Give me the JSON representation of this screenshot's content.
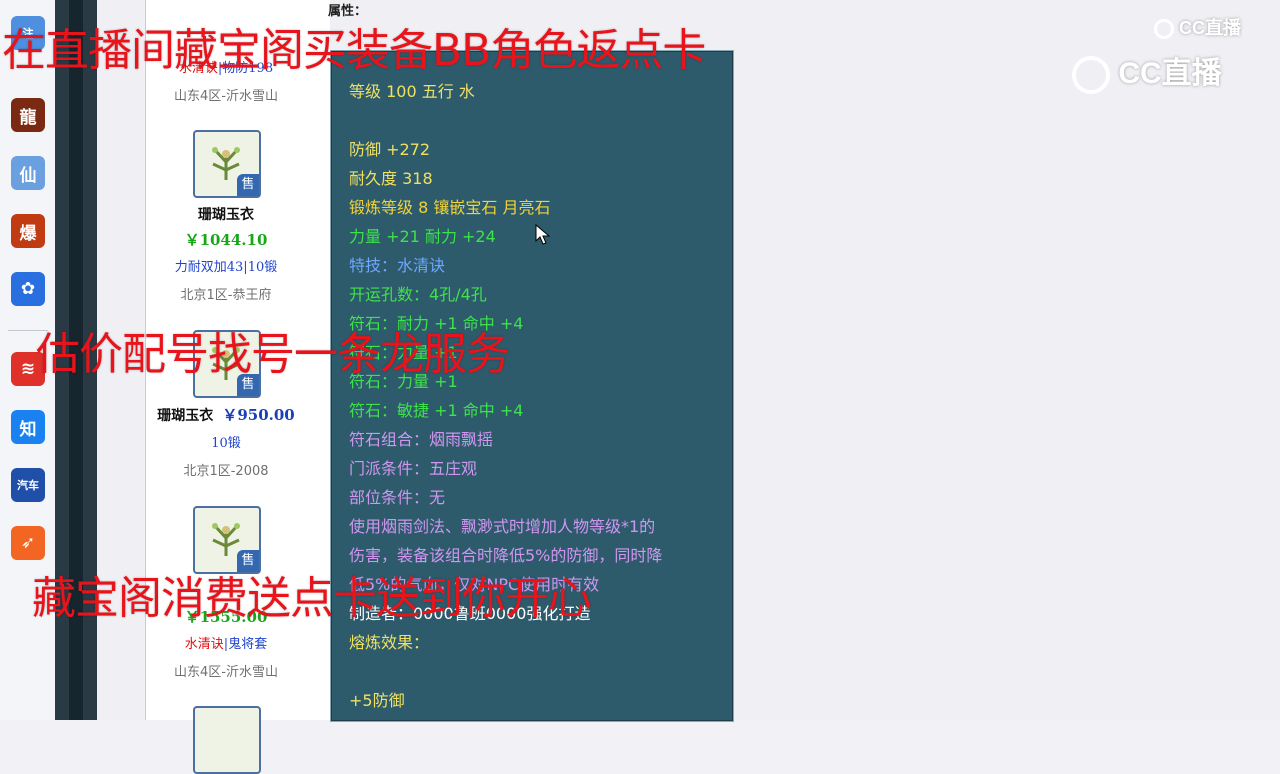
{
  "taskbar": {
    "icons": [
      {
        "name": "game-dragon-icon",
        "glyph": "龍",
        "color": "#7a2a12"
      },
      {
        "name": "game-fairy-icon",
        "glyph": "仙",
        "color": "#6aa0e0"
      },
      {
        "name": "game-explode-icon",
        "glyph": "爆",
        "color": "#c03a12"
      },
      {
        "name": "baidu-icon",
        "glyph": "✿",
        "color": "#2a6fe0"
      },
      {
        "name": "app-wave-icon",
        "glyph": "≋",
        "color": "#e0302a"
      },
      {
        "name": "zhihu-icon",
        "glyph": "知",
        "color": "#1a82f0"
      },
      {
        "name": "car-icon",
        "glyph": "汽车",
        "color": "#1f4fa8"
      },
      {
        "name": "app-bird-icon",
        "glyph": "➶",
        "color": "#f26522"
      }
    ]
  },
  "listing": {
    "items": [
      {
        "name": "珊瑚玉衣",
        "price": "￥1044.10",
        "attr_a": "力耐双加43",
        "attr_b": "10锻",
        "server": "北京1区-恭王府"
      },
      {
        "name": "珊瑚玉衣",
        "price": "￥950.00",
        "attr_a": "10锻",
        "server": "北京1区-2008"
      }
    ],
    "partial_top": {
      "attr_a": "水清诀",
      "attr_b": "物防198",
      "server": "山东4区-沂水雪山"
    },
    "partial_bottom": {
      "price": "￥1555.00",
      "attr_a": "水清诀",
      "attr_b": "鬼将套",
      "server": "山东4区-沂水雪山"
    },
    "sale_badge": "售"
  },
  "tooltip": {
    "top_cut": "属性：",
    "level_line": "等级 100 五行 水",
    "defense": "防御 +272",
    "durability": "耐久度 318",
    "forge": "锻炼等级 8 镶嵌宝石 月亮石",
    "strength": "力量 +21 耐力 +24",
    "skill": "特技：水清诀",
    "slots": "开运孔数：4孔/4孔",
    "rune1": "符石：耐力 +1 命中 +4",
    "rune2": "符石：力量 +1",
    "rune3": "符石：力量 +1",
    "rune4": "符石：敏捷 +1 命中 +4",
    "rune_combo": "符石组合：烟雨飘摇",
    "school": "门派条件：五庄观",
    "slot_req": "部位条件：无",
    "desc1": "使用烟雨剑法、飘渺式时增加人物等级*1的",
    "desc2": "伤害，装备该组合时降低5%的防御，同时降",
    "desc3": "低5%的气血，仅对NPC使用时有效",
    "maker": "制造者：0000鲁班0000强化打造",
    "smelt": "熔炼效果：",
    "smelt_val": "+5防御"
  },
  "overlay_texts": {
    "line1": "在直播间藏宝阁买装备BB角色返点卡",
    "line2": "估价配号找号一条龙服务",
    "line3": "藏宝阁消费送点卡送到你开心"
  },
  "watermark": {
    "small": "CC直播",
    "large": "CC直播"
  }
}
